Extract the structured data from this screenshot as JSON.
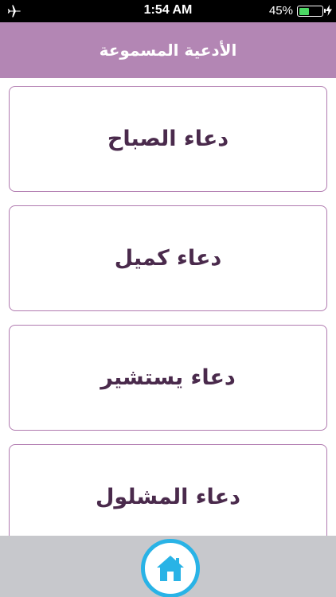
{
  "status_bar": {
    "time": "1:54 AM",
    "battery_percent": "45%",
    "battery_level": 0.45,
    "battery_color": "#4cd964"
  },
  "header": {
    "title": "الأدعية المسموعة",
    "background_color": "#b386b4"
  },
  "prayers": [
    {
      "label": "دعاء الصباح"
    },
    {
      "label": "دعاء كميل"
    },
    {
      "label": "دعاء يستشير"
    },
    {
      "label": "دعاء المشلول"
    }
  ],
  "bottom_bar": {
    "home_icon": "home-icon",
    "accent_color": "#29b3e6"
  }
}
